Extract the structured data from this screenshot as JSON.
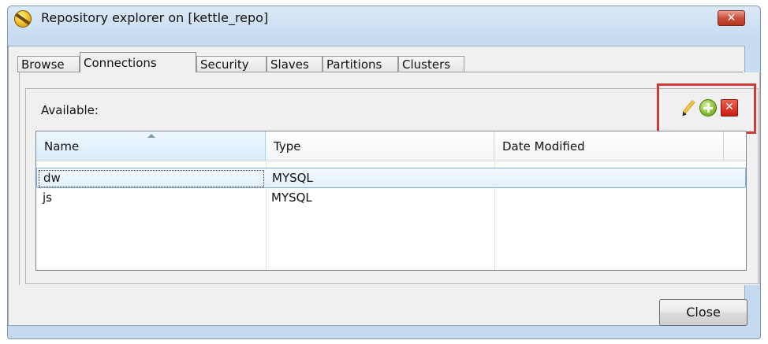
{
  "window": {
    "title": "Repository explorer on [kettle_repo]",
    "close_glyph": "✕"
  },
  "tabs": [
    {
      "label": "Browse",
      "active": false
    },
    {
      "label": "Connections",
      "active": true
    },
    {
      "label": "Security",
      "active": false
    },
    {
      "label": "Slaves",
      "active": false
    },
    {
      "label": "Partitions",
      "active": false
    },
    {
      "label": "Clusters",
      "active": false
    }
  ],
  "connections": {
    "available_label": "Available:",
    "toolbar": {
      "edit_icon": "pencil-icon",
      "add_icon": "add-icon",
      "delete_icon": "delete-icon",
      "delete_glyph": "✕"
    },
    "columns": [
      "Name",
      "Type",
      "Date Modified"
    ],
    "sorted_column": "Name",
    "rows": [
      {
        "name": "dw",
        "type": "MYSQL",
        "date_modified": "",
        "selected": true
      },
      {
        "name": "js",
        "type": "MYSQL",
        "date_modified": "",
        "selected": false
      }
    ]
  },
  "footer": {
    "close_label": "Close"
  },
  "colors": {
    "highlight_box": "#d23a3a",
    "selection_border": "#84acdd",
    "frame": "#c4d8ee"
  }
}
